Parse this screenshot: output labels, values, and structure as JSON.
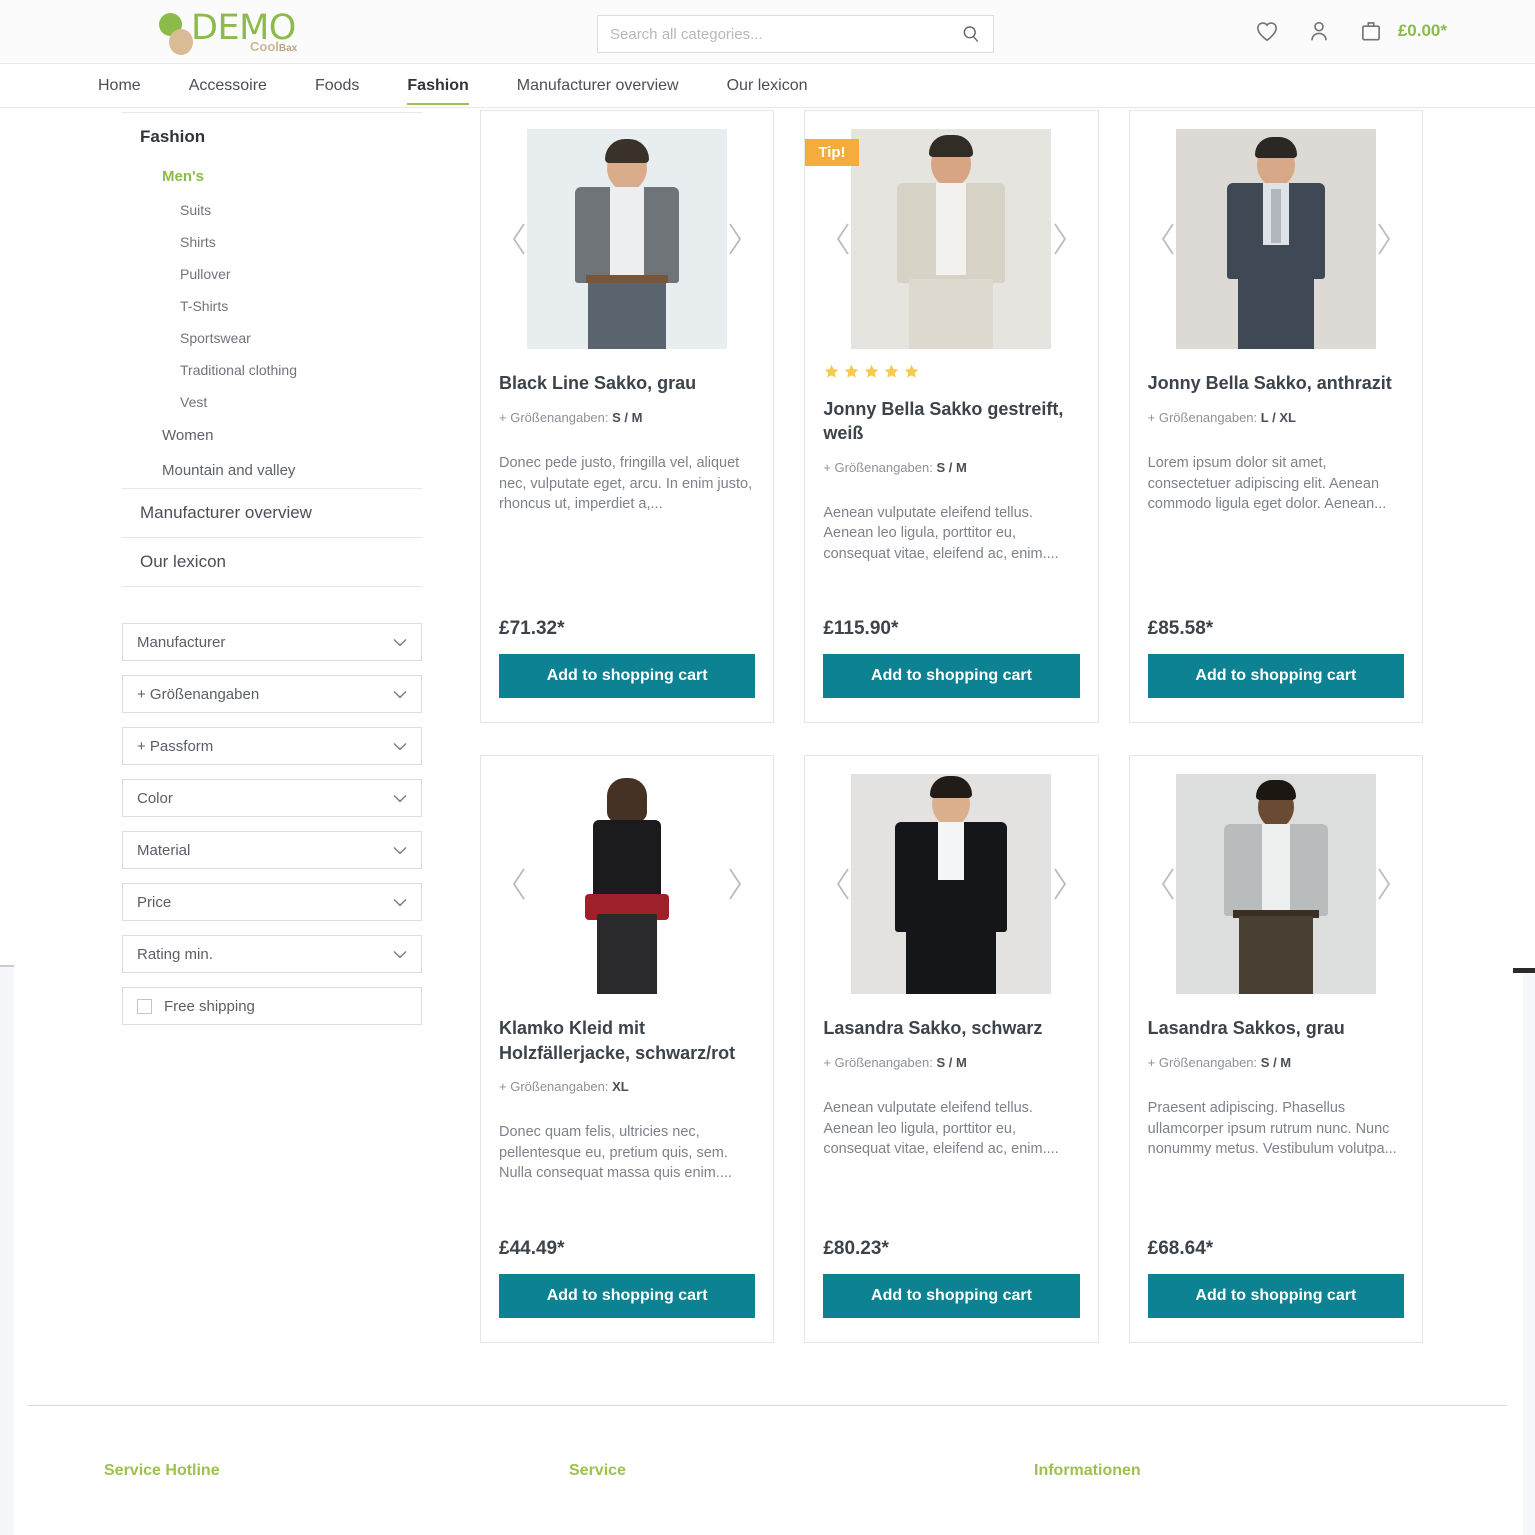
{
  "header": {
    "logo": {
      "name": "DEMO",
      "subtitle_main": "Cool",
      "subtitle_accent": "Bax"
    },
    "search": {
      "placeholder": "Search all categories...",
      "value": ""
    },
    "cart_total": "£0.00*",
    "icons": [
      "heart-icon",
      "account-icon",
      "cart-icon"
    ]
  },
  "mainnav": {
    "items": [
      {
        "label": "Home",
        "active": false
      },
      {
        "label": "Accessoire",
        "active": false
      },
      {
        "label": "Foods",
        "active": false
      },
      {
        "label": "Fashion",
        "active": true
      },
      {
        "label": "Manufacturer overview",
        "active": false
      },
      {
        "label": "Our lexicon",
        "active": false
      }
    ]
  },
  "sidebar": {
    "category_title": "Fashion",
    "mens": "Men's",
    "mens_children": [
      "Suits",
      "Shirts",
      "Pullover",
      "T-Shirts",
      "Sportswear",
      "Traditional clothing",
      "Vest"
    ],
    "siblings": [
      "Women",
      "Mountain and valley"
    ],
    "links": [
      "Manufacturer overview",
      "Our lexicon"
    ],
    "filters": [
      {
        "label": "Manufacturer",
        "type": "dropdown"
      },
      {
        "label": "+ Größenangaben",
        "type": "dropdown"
      },
      {
        "label": "+ Passform",
        "type": "dropdown"
      },
      {
        "label": "Color",
        "type": "dropdown"
      },
      {
        "label": "Material",
        "type": "dropdown"
      },
      {
        "label": "Price",
        "type": "dropdown"
      },
      {
        "label": "Rating min.",
        "type": "dropdown"
      }
    ],
    "free_shipping": {
      "label": "Free shipping",
      "checked": false
    }
  },
  "products": [
    {
      "title": "Black Line Sakko, grau",
      "size_label": "+ Größenangaben:",
      "size_value": "S / M",
      "description": "Donec pede justo, fringilla vel, aliquet nec, vulputate eget, arcu. In enim justo, rhoncus ut, imperdiet a,...",
      "price": "£71.32*",
      "cta": "Add to shopping cart",
      "badge": "",
      "rating": 0,
      "image": {
        "bg": "#e8edf0",
        "suit": "#6f7478",
        "shirt": "#eceef0",
        "pants": "#5a646e",
        "skin": "#d9ad8b",
        "hair": "#3a3128"
      }
    },
    {
      "title": "Jonny Bella Sakko gestreift, weiß",
      "size_label": "+ Größenangaben:",
      "size_value": "S / M",
      "description": "Aenean vulputate eleifend tellus. Aenean leo ligula, porttitor eu, consequat vitae, eleifend ac, enim....",
      "price": "£115.90*",
      "cta": "Add to shopping cart",
      "badge": "Tip!",
      "rating": 5,
      "image": {
        "bg": "#e6e4df",
        "suit": "#d6d2c6",
        "shirt": "#f2f1ee",
        "pants": "#ddd9cf",
        "skin": "#d7a583",
        "hair": "#322c26"
      }
    },
    {
      "title": "Jonny Bella Sakko, anthrazit",
      "size_label": "+ Größenangaben:",
      "size_value": "L / XL",
      "description": "Lorem ipsum dolor sit amet, consectetuer adipiscing elit. Aenean commodo ligula eget dolor. Aenean...",
      "price": "£85.58*",
      "cta": "Add to shopping cart",
      "badge": "",
      "rating": 0,
      "image": {
        "bg": "#ddd9d4",
        "suit": "#3f4855",
        "shirt": "#dfe2e6",
        "pants": "#3f4855",
        "skin": "#d7a988",
        "hair": "#2b2722"
      }
    },
    {
      "title": "Klamko Kleid mit Holzfällerjacke, schwarz/rot",
      "size_label": "+ Größenangaben:",
      "size_value": "XL",
      "description": "Donec quam felis, ultricies nec, pellentesque eu, pretium quis, sem. Nulla consequat massa quis enim....",
      "price": "£44.49*",
      "cta": "Add to shopping cart",
      "badge": "",
      "rating": 0,
      "image": {
        "bg": "#ffffff",
        "suit": "#1b1b1d",
        "shirt": "#1b1b1d",
        "pants": "#2a2a2c",
        "skin": "#e2b894",
        "hair": "#463225"
      }
    },
    {
      "title": "Lasandra Sakko, schwarz",
      "size_label": "+ Größenangaben:",
      "size_value": "S / M",
      "description": "Aenean vulputate eleifend tellus. Aenean leo ligula, porttitor eu, consequat vitae, eleifend ac, enim....",
      "price": "£80.23*",
      "cta": "Add to shopping cart",
      "badge": "",
      "rating": 0,
      "image": {
        "bg": "#e4e2e0",
        "suit": "#15161a",
        "shirt": "#f4f5f6",
        "pants": "#15161a",
        "skin": "#dcb08c",
        "hair": "#221c18"
      }
    },
    {
      "title": "Lasandra Sakkos, grau",
      "size_label": "+ Größenangaben:",
      "size_value": "S / M",
      "description": "Praesent adipiscing. Phasellus ullamcorper ipsum rutrum nunc. Nunc nonummy metus. Vestibulum volutpa...",
      "price": "£68.64*",
      "cta": "Add to shopping cart",
      "badge": "",
      "rating": 0,
      "image": {
        "bg": "#dcdedd",
        "suit": "#b9bcbc",
        "shirt": "#eef0f0",
        "pants": "#4a3f33",
        "skin": "#6b4a34",
        "hair": "#1d1712"
      }
    }
  ],
  "footer": {
    "columns": [
      {
        "heading": "Service Hotline"
      },
      {
        "heading": "Service"
      },
      {
        "heading": "Informationen"
      }
    ]
  },
  "colors": {
    "brand_green": "#8cbb4a",
    "nav_underline": "#9dc04f",
    "cta_teal": "#0d8292",
    "badge_orange": "#f5ac3c",
    "star_gold": "#f7ca4d"
  }
}
